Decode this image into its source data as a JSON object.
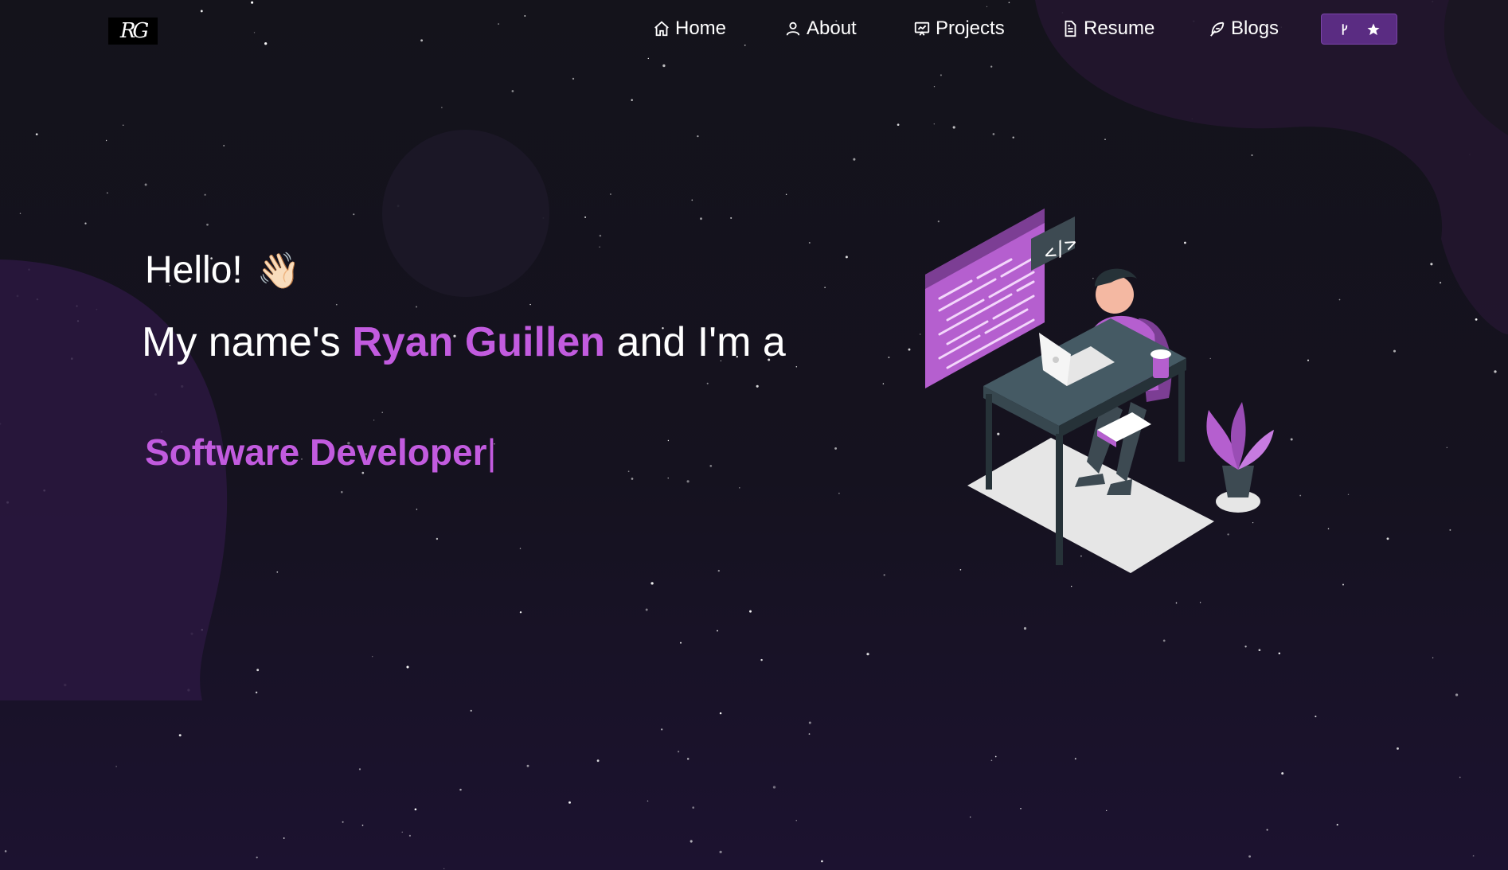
{
  "navbar": {
    "logo_text": "RG",
    "items": [
      {
        "label": "Home",
        "icon": "home-icon"
      },
      {
        "label": "About",
        "icon": "user-icon"
      },
      {
        "label": "Projects",
        "icon": "projects-icon"
      },
      {
        "label": "Resume",
        "icon": "document-icon"
      },
      {
        "label": "Blogs",
        "icon": "feather-icon"
      }
    ],
    "github_button": {
      "icons": [
        "git-fork-icon",
        "star-icon"
      ]
    }
  },
  "hero": {
    "greeting": "Hello!",
    "wave_emoji": "👋🏻",
    "intro_before": "My name's",
    "name": "Ryan Guillen",
    "intro_after": "and I'm a",
    "role": "Software Developer",
    "cursor": "|"
  },
  "colors": {
    "background": "#14131b",
    "accent": "#c25bdf",
    "button": "#5a2c82",
    "text": "#ffffff"
  }
}
